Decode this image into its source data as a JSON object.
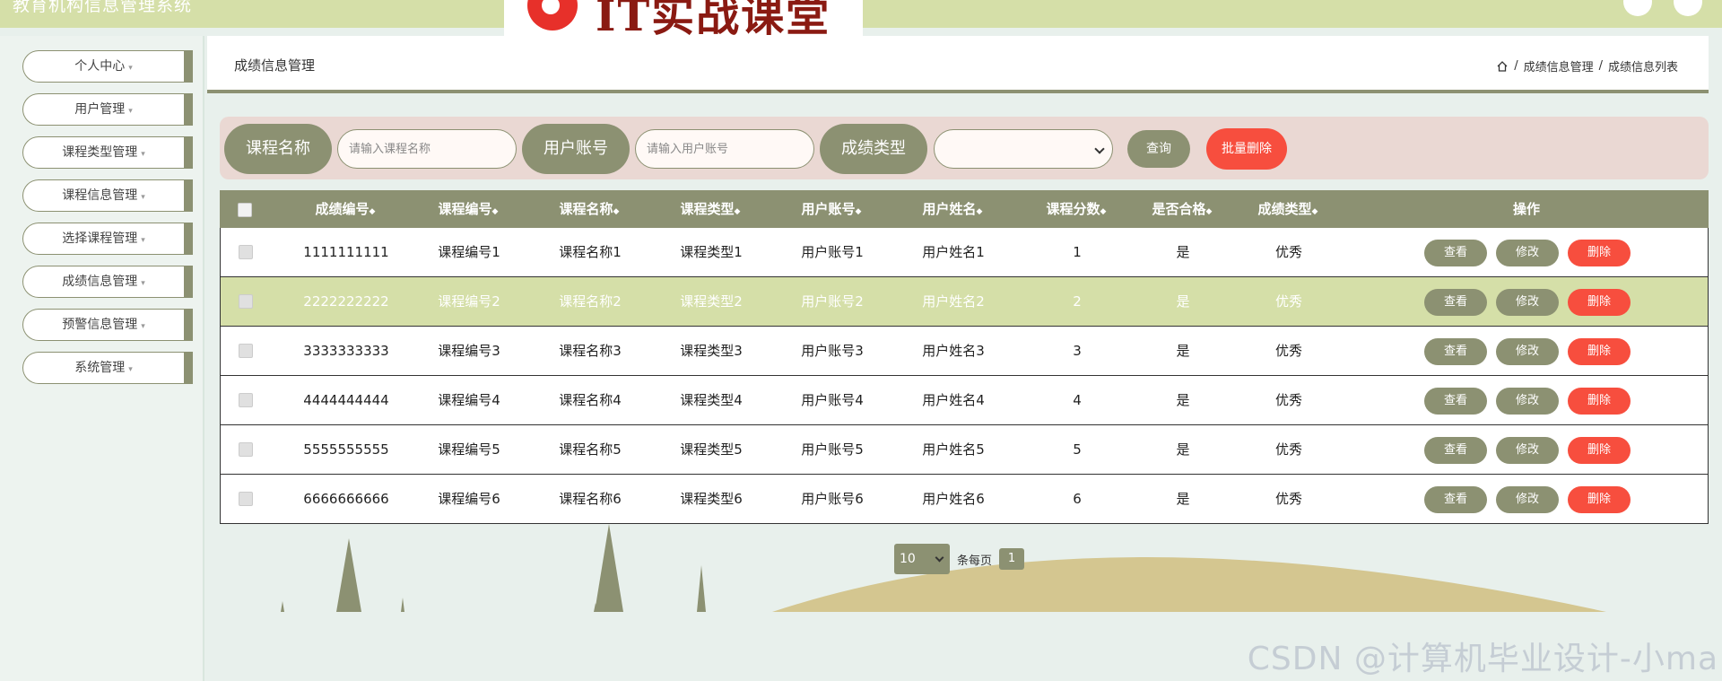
{
  "app": {
    "title": "教育机构信息管理系统",
    "logo_text": "IT实战课堂"
  },
  "sidebar": {
    "items": [
      {
        "label": "个人中心"
      },
      {
        "label": "用户管理"
      },
      {
        "label": "课程类型管理"
      },
      {
        "label": "课程信息管理"
      },
      {
        "label": "选择课程管理"
      },
      {
        "label": "成绩信息管理"
      },
      {
        "label": "预警信息管理"
      },
      {
        "label": "系统管理"
      }
    ],
    "caret": "▾"
  },
  "header": {
    "title": "成绩信息管理",
    "breadcrumb": [
      "成绩信息管理",
      "成绩信息列表"
    ],
    "separator": "/"
  },
  "search": {
    "course_name_label": "课程名称",
    "course_name_placeholder": "请输入课程名称",
    "user_account_label": "用户账号",
    "user_account_placeholder": "请输入用户账号",
    "grade_type_label": "成绩类型",
    "grade_type_value": "",
    "query_label": "查询",
    "batch_delete_label": "批量删除"
  },
  "table": {
    "columns": [
      "成绩编号",
      "课程编号",
      "课程名称",
      "课程类型",
      "用户账号",
      "用户姓名",
      "课程分数",
      "是否合格",
      "成绩类型",
      "操作"
    ],
    "sort_icon": "◆",
    "rows": [
      {
        "id": "1111111111",
        "course_no": "课程编号1",
        "course_name": "课程名称1",
        "course_type": "课程类型1",
        "account": "用户账号1",
        "name": "用户姓名1",
        "score": "1",
        "passed": "是",
        "grade_type": "优秀"
      },
      {
        "id": "2222222222",
        "course_no": "课程编号2",
        "course_name": "课程名称2",
        "course_type": "课程类型2",
        "account": "用户账号2",
        "name": "用户姓名2",
        "score": "2",
        "passed": "是",
        "grade_type": "优秀"
      },
      {
        "id": "3333333333",
        "course_no": "课程编号3",
        "course_name": "课程名称3",
        "course_type": "课程类型3",
        "account": "用户账号3",
        "name": "用户姓名3",
        "score": "3",
        "passed": "是",
        "grade_type": "优秀"
      },
      {
        "id": "4444444444",
        "course_no": "课程编号4",
        "course_name": "课程名称4",
        "course_type": "课程类型4",
        "account": "用户账号4",
        "name": "用户姓名4",
        "score": "4",
        "passed": "是",
        "grade_type": "优秀"
      },
      {
        "id": "5555555555",
        "course_no": "课程编号5",
        "course_name": "课程名称5",
        "course_type": "课程类型5",
        "account": "用户账号5",
        "name": "用户姓名5",
        "score": "5",
        "passed": "是",
        "grade_type": "优秀"
      },
      {
        "id": "6666666666",
        "course_no": "课程编号6",
        "course_name": "课程名称6",
        "course_type": "课程类型6",
        "account": "用户账号6",
        "name": "用户姓名6",
        "score": "6",
        "passed": "是",
        "grade_type": "优秀"
      }
    ],
    "action_labels": {
      "view": "查看",
      "edit": "修改",
      "delete": "删除"
    }
  },
  "pagination": {
    "page_size": "10",
    "per_page_label": "条每页",
    "current_page": "1"
  },
  "watermark": "CSDN @计算机毕业设计-小ma",
  "colors": {
    "accent": "#8c9172",
    "topbar": "#d5dfa8",
    "danger": "#f74e3e",
    "search_bg": "#ead8d3",
    "row_highlight": "#d5dfa8"
  }
}
